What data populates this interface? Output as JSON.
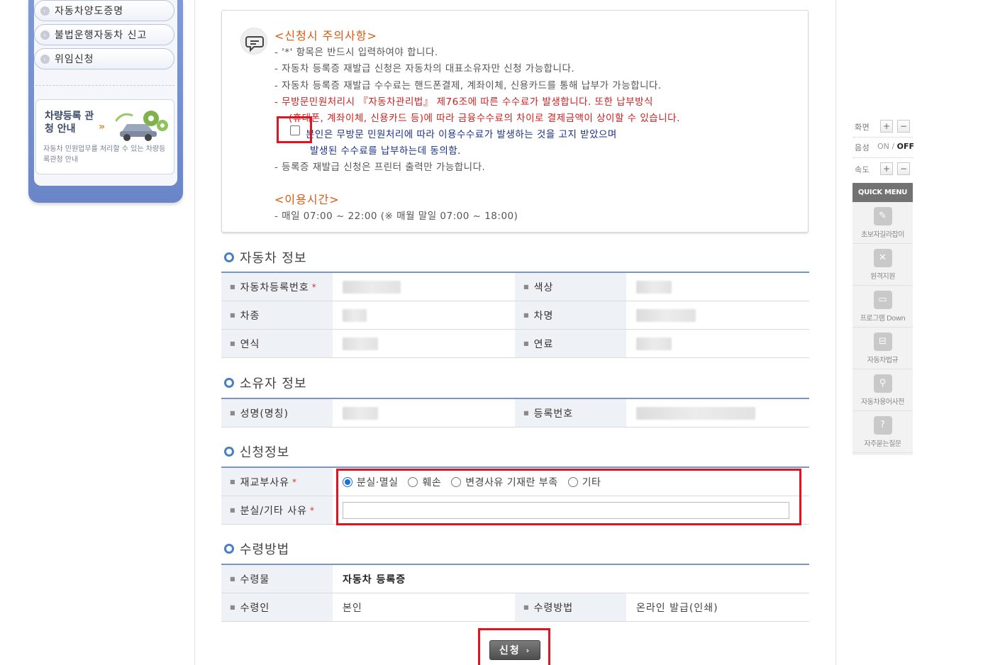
{
  "sidebar": {
    "items": [
      {
        "label": "자동차양도증명"
      },
      {
        "label": "불법운행자동차 신고"
      },
      {
        "label": "위임신청"
      }
    ],
    "guide": {
      "title": "차량등록 관청 안내",
      "arrow": "»",
      "desc": "자동차 민원업무를 처리할 수 있는 차량등록관청 안내"
    }
  },
  "notice": {
    "heading": "<신청시 주의사항>",
    "lines": [
      "- '*' 항목은 반드시 입력하여야 합니다.",
      "- 자동차 등록증 재발급 신청은 자동차의 대표소유자만 신청 가능합니다.",
      "- 자동차 등록증 재발급 수수료는 핸드폰결제, 계좌이체, 신용카드를 통해 납부가 가능합니다."
    ],
    "red_line_1": "- 무방문민원처리시 『자동차관리법』 제76조에 따른 수수료가 발생합니다. 또한 납부방식",
    "red_line_2": "(휴대폰, 계좌이체, 신용카드 등)에 따라 금융수수료의 차이로 결제금액이 상이할 수 있습니다.",
    "agree_line_1": "본인은 무방문 민원처리에 따라 이용수수료가 발생하는 것을 고지 받았으며",
    "agree_line_2": "발생된 수수료를 납부하는데 동의함.",
    "print_line": "- 등록증 재발급 신청은 프린터 출력만 가능합니다.",
    "hours_heading": "<이용시간>",
    "hours_line": "- 매일 07:00 ~ 22:00 (※ 매월 말일 07:00 ~ 18:00)"
  },
  "vehicle": {
    "heading": "자동차 정보",
    "reg_no_label": "자동차등록번호",
    "color_label": "색상",
    "type_label": "차종",
    "name_label": "차명",
    "year_label": "연식",
    "fuel_label": "연료"
  },
  "owner": {
    "heading": "소유자 정보",
    "name_label": "성명(명칭)",
    "reg_label": "등록번호"
  },
  "application": {
    "heading": "신청정보",
    "reason_label": "재교부사유",
    "options": [
      "분실·멸실",
      "훼손",
      "변경사유 기재란 부족",
      "기타"
    ],
    "selected": "분실·멸실",
    "detail_label": "분실/기타 사유",
    "detail_value": ""
  },
  "receipt": {
    "heading": "수령방법",
    "item_label": "수령물",
    "item_value": "자동차 등록증",
    "receiver_label": "수령인",
    "receiver_value": "본인",
    "method_label": "수령방법",
    "method_value": "온라인 발급(인쇄)"
  },
  "submit_label": "신청",
  "required_mark": "*",
  "right_panel": {
    "screen_label": "화면",
    "sound_label": "음성",
    "sound_on": "ON",
    "sound_off": "OFF",
    "speed_label": "속도",
    "plus": "+",
    "minus": "−",
    "quick_menu": "QUICK MENU",
    "quick_items": [
      {
        "label": "초보자길라잡이",
        "icon": "guide-icon"
      },
      {
        "label": "원격지원",
        "icon": "tools-icon"
      },
      {
        "label": "프로그램 Down",
        "icon": "monitor-icon"
      },
      {
        "label": "자동차법규",
        "icon": "car-icon"
      },
      {
        "label": "자동차용어사전",
        "icon": "dictionary-icon"
      },
      {
        "label": "자주묻는질문",
        "icon": "faq-icon"
      }
    ]
  },
  "colors": {
    "accent_blue": "#7795c5",
    "highlight_red": "#e3141f",
    "notice_orange": "#d85a10",
    "notice_red": "#cc1e1e",
    "notice_blue": "#1a2f8a"
  }
}
